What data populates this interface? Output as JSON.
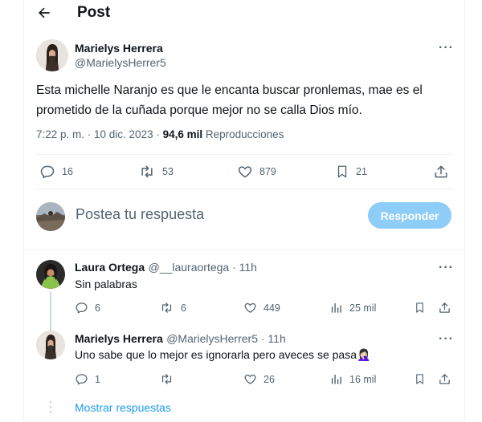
{
  "header": {
    "title": "Post"
  },
  "post": {
    "name": "Marielys Herrera",
    "handle": "@MarielysHerrer5",
    "text": "Esta michelle Naranjo es que le encanta buscar pronlemas, mae es el prometido de la cuñada porque mejor no se calla Dios mío.",
    "time": "7:22 p. m. · 10 dic. 2023 · ",
    "views": "94,6 mil",
    "views_label": " Reproducciones",
    "replies": "16",
    "reposts": "53",
    "likes": "879",
    "bookmarks": "21"
  },
  "composer": {
    "placeholder": "Postea tu respuesta",
    "button": "Responder"
  },
  "replies": [
    {
      "name": "Laura Ortega",
      "handle": "@__lauraortega · 11h",
      "text": "Sin palabras",
      "replies": "6",
      "reposts": "6",
      "likes": "449",
      "views": "25 mil"
    },
    {
      "name": "Marielys Herrera",
      "handle": "@MarielysHerrer5 · 11h",
      "text": "Uno sabe que lo mejor es ignorarla pero aveces se pasa🤦🏻‍♀️",
      "replies": "1",
      "reposts": "",
      "likes": "26",
      "views": "16 mil"
    }
  ],
  "show_replies": "Mostrar respuestas",
  "colors": {
    "accent": "#1d9bf0",
    "button_disabled": "#8ecdf8",
    "muted": "#536471"
  }
}
